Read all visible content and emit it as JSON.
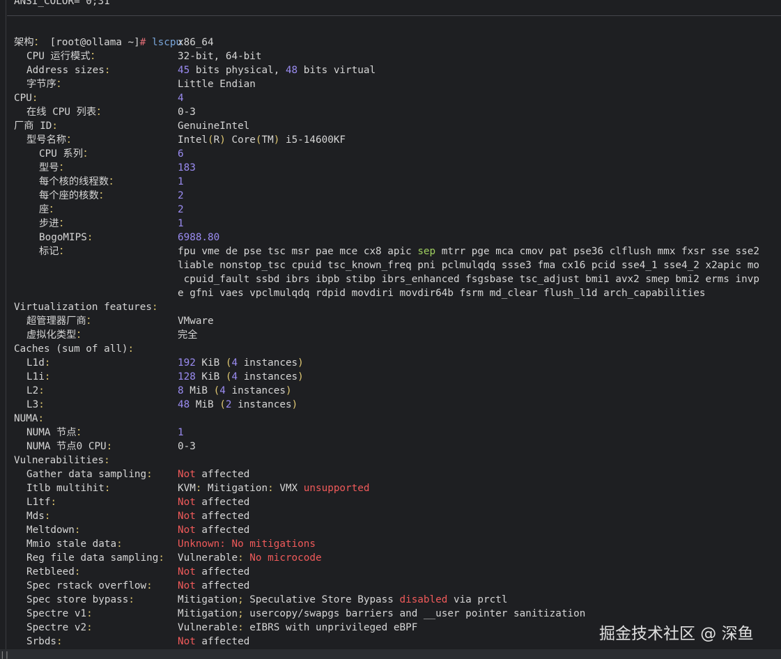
{
  "top_line": "ANSI_COLOR=\"0;31\"",
  "prompt": {
    "user_host": "[root@ollama ~]",
    "hash": "#",
    "command": " lscpu"
  },
  "rows": [
    {
      "level": 0,
      "key": "架构",
      "val": [
        [
          "x86_64",
          ""
        ]
      ]
    },
    {
      "level": 1,
      "key": "CPU 运行模式",
      "val": [
        [
          "32-bit, 64-bit",
          ""
        ]
      ]
    },
    {
      "level": 1,
      "key": "Address sizes",
      "val": [
        [
          "45",
          "num"
        ],
        [
          " bits physical, ",
          ""
        ],
        [
          "48",
          "num"
        ],
        [
          " bits virtual",
          ""
        ]
      ]
    },
    {
      "level": 1,
      "key": "字节序",
      "val": [
        [
          "Little Endian",
          ""
        ]
      ]
    },
    {
      "level": 0,
      "key": "CPU",
      "val": [
        [
          "4",
          "num"
        ]
      ]
    },
    {
      "level": 1,
      "key": "在线 CPU 列表",
      "val": [
        [
          "0-3",
          ""
        ]
      ]
    },
    {
      "level": 0,
      "key": "厂商 ID",
      "val": [
        [
          "GenuineIntel",
          ""
        ]
      ]
    },
    {
      "level": 1,
      "key": "型号名称",
      "val": [
        [
          "Intel",
          ""
        ],
        [
          "(",
          "par"
        ],
        [
          "R",
          ""
        ],
        [
          ")",
          "par"
        ],
        [
          " Core",
          ""
        ],
        [
          "(",
          "par"
        ],
        [
          "TM",
          ""
        ],
        [
          ")",
          "par"
        ],
        [
          " i5-14600KF",
          ""
        ]
      ]
    },
    {
      "level": 2,
      "key": "CPU 系列",
      "val": [
        [
          "6",
          "num"
        ]
      ]
    },
    {
      "level": 2,
      "key": "型号",
      "val": [
        [
          "183",
          "num"
        ]
      ]
    },
    {
      "level": 2,
      "key": "每个核的线程数",
      "val": [
        [
          "1",
          "num"
        ]
      ]
    },
    {
      "level": 2,
      "key": "每个座的核数",
      "val": [
        [
          "2",
          "num"
        ]
      ]
    },
    {
      "level": 2,
      "key": "座",
      "val": [
        [
          "2",
          "num"
        ]
      ]
    },
    {
      "level": 2,
      "key": "步进",
      "val": [
        [
          "1",
          "num"
        ]
      ]
    },
    {
      "level": 2,
      "key": "BogoMIPS",
      "val": [
        [
          "6988.80",
          "num"
        ]
      ]
    },
    {
      "level": 2,
      "key": "标记",
      "val": [
        [
          "fpu vme de pse tsc msr pae mce cx8 apic ",
          ""
        ],
        [
          "sep",
          "grn"
        ],
        [
          " mtrr pge mca cmov pat pse36 clflush mmx fxsr sse sse2",
          ""
        ]
      ]
    },
    {
      "level": -1,
      "key": "",
      "val": [
        [
          "liable nonstop_tsc cpuid tsc_known_freq pni pclmulqdq ssse3 fma cx16 pcid sse4_1 sse4_2 x2apic mo",
          ""
        ]
      ]
    },
    {
      "level": -1,
      "key": "",
      "val": [
        [
          " cpuid_fault ssbd ibrs ibpb stibp ibrs_enhanced fsgsbase tsc_adjust bmi1 avx2 smep bmi2 erms invp",
          ""
        ]
      ]
    },
    {
      "level": -1,
      "key": "",
      "val": [
        [
          "e gfni vaes vpclmulqdq rdpid movdiri movdir64b fsrm md_clear flush_l1d arch_capabilities",
          ""
        ]
      ]
    },
    {
      "level": 0,
      "key": "Virtualization features",
      "val": []
    },
    {
      "level": 1,
      "key": "超管理器厂商",
      "val": [
        [
          "VMware",
          ""
        ]
      ]
    },
    {
      "level": 1,
      "key": "虚拟化类型",
      "val": [
        [
          "完全",
          ""
        ]
      ]
    },
    {
      "level": 0,
      "key": "Caches (sum of all)",
      "val": []
    },
    {
      "level": 1,
      "key": "L1d",
      "val": [
        [
          "192",
          "num"
        ],
        [
          " KiB ",
          ""
        ],
        [
          "(",
          "par"
        ],
        [
          "4",
          "num"
        ],
        [
          " instances",
          ""
        ],
        [
          ")",
          "par"
        ]
      ]
    },
    {
      "level": 1,
      "key": "L1i",
      "val": [
        [
          "128",
          "num"
        ],
        [
          " KiB ",
          ""
        ],
        [
          "(",
          "par"
        ],
        [
          "4",
          "num"
        ],
        [
          " instances",
          ""
        ],
        [
          ")",
          "par"
        ]
      ]
    },
    {
      "level": 1,
      "key": "L2",
      "val": [
        [
          "8",
          "num"
        ],
        [
          " MiB ",
          ""
        ],
        [
          "(",
          "par"
        ],
        [
          "4",
          "num"
        ],
        [
          " instances",
          ""
        ],
        [
          ")",
          "par"
        ]
      ]
    },
    {
      "level": 1,
      "key": "L3",
      "val": [
        [
          "48",
          "num"
        ],
        [
          " MiB ",
          ""
        ],
        [
          "(",
          "par"
        ],
        [
          "2",
          "num"
        ],
        [
          " instances",
          ""
        ],
        [
          ")",
          "par"
        ]
      ]
    },
    {
      "level": 0,
      "key": "NUMA",
      "val": []
    },
    {
      "level": 1,
      "key": "NUMA 节点",
      "val": [
        [
          "1",
          "num"
        ]
      ]
    },
    {
      "level": 1,
      "key": "NUMA 节点0 CPU",
      "val": [
        [
          "0-3",
          ""
        ]
      ]
    },
    {
      "level": 0,
      "key": "Vulnerabilities",
      "val": []
    },
    {
      "level": 1,
      "key": "Gather data sampling",
      "val": [
        [
          "Not",
          "red"
        ],
        [
          " affected",
          ""
        ]
      ]
    },
    {
      "level": 1,
      "key": "Itlb multihit",
      "val": [
        [
          "KVM",
          ""
        ],
        [
          ":",
          "par"
        ],
        [
          " Mitigation",
          ""
        ],
        [
          ":",
          "par"
        ],
        [
          " VMX ",
          ""
        ],
        [
          "unsupported",
          "red"
        ]
      ]
    },
    {
      "level": 1,
      "key": "L1tf",
      "val": [
        [
          "Not",
          "red"
        ],
        [
          " affected",
          ""
        ]
      ]
    },
    {
      "level": 1,
      "key": "Mds",
      "val": [
        [
          "Not",
          "red"
        ],
        [
          " affected",
          ""
        ]
      ]
    },
    {
      "level": 1,
      "key": "Meltdown",
      "val": [
        [
          "Not",
          "red"
        ],
        [
          " affected",
          ""
        ]
      ]
    },
    {
      "level": 1,
      "key": "Mmio stale data",
      "val": [
        [
          "Unknown: No mitigations",
          "red"
        ]
      ]
    },
    {
      "level": 1,
      "key": "Reg file data sampling",
      "val": [
        [
          "Vulnerable",
          ""
        ],
        [
          ":",
          "par"
        ],
        [
          " No microcode",
          "red"
        ]
      ]
    },
    {
      "level": 1,
      "key": "Retbleed",
      "val": [
        [
          "Not",
          "red"
        ],
        [
          " affected",
          ""
        ]
      ]
    },
    {
      "level": 1,
      "key": "Spec rstack overflow",
      "val": [
        [
          "Not",
          "red"
        ],
        [
          " affected",
          ""
        ]
      ]
    },
    {
      "level": 1,
      "key": "Spec store bypass",
      "val": [
        [
          "Mitigation",
          ""
        ],
        [
          ";",
          "par"
        ],
        [
          " Speculative Store Bypass ",
          ""
        ],
        [
          "disabled",
          "red"
        ],
        [
          " via prctl",
          ""
        ]
      ]
    },
    {
      "level": 1,
      "key": "Spectre v1",
      "val": [
        [
          "Mitigation",
          ""
        ],
        [
          ";",
          "par"
        ],
        [
          " usercopy/swapgs barriers and __user pointer sanitization",
          ""
        ]
      ]
    },
    {
      "level": 1,
      "key": "Spectre v2",
      "val": [
        [
          "Vulnerable",
          ""
        ],
        [
          ":",
          "par"
        ],
        [
          " eIBRS with unprivileged eBPF",
          ""
        ]
      ]
    },
    {
      "level": 1,
      "key": "Srbds",
      "val": [
        [
          "Not",
          "red"
        ],
        [
          " affected",
          ""
        ]
      ]
    }
  ],
  "watermark": "掘金技术社区 @ 深鱼",
  "bottom_mark": "||"
}
